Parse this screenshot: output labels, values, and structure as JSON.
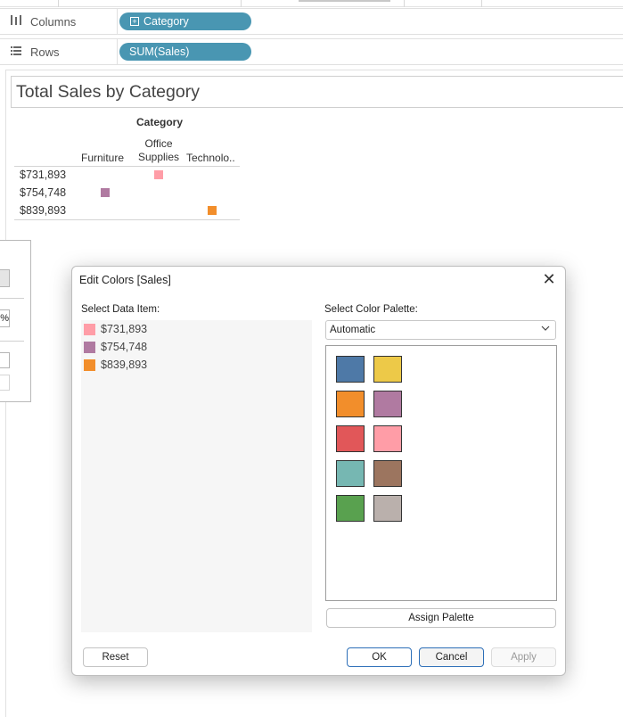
{
  "shelves": {
    "columns": {
      "label": "Columns",
      "icon": "columns-icon",
      "pill": "Category"
    },
    "rows": {
      "label": "Rows",
      "icon": "rows-icon",
      "pill": "SUM(Sales)"
    }
  },
  "sheet": {
    "title": "Total Sales by Category",
    "column_header": "Category",
    "columns": [
      "Furniture",
      "Office Supplies",
      "Technolo.."
    ],
    "rows": [
      "$731,893",
      "$754,748",
      "$839,893"
    ]
  },
  "side_panel": {
    "percent_text": "%"
  },
  "dialog": {
    "title": "Edit Colors [Sales]",
    "select_data_item_label": "Select Data Item:",
    "select_palette_label": "Select Color Palette:",
    "palette_selected": "Automatic",
    "data_items": [
      {
        "label": "$731,893",
        "color": "#ff9da7"
      },
      {
        "label": "$754,748",
        "color": "#b07aa1"
      },
      {
        "label": "$839,893",
        "color": "#f28e2b"
      }
    ],
    "palette_colors": [
      "#4e79a7",
      "#edc948",
      "#f28e2b",
      "#b07aa1",
      "#e15759",
      "#ff9da7",
      "#76b7b2",
      "#9c755f",
      "#59a14f",
      "#bab0ac"
    ],
    "buttons": {
      "assign_palette": "Assign Palette",
      "reset": "Reset",
      "ok": "OK",
      "cancel": "Cancel",
      "apply": "Apply"
    }
  },
  "chart_data": {
    "type": "scatter",
    "title": "Total Sales by Category",
    "x_label": "Category",
    "categories": [
      "Furniture",
      "Office Supplies",
      "Technology"
    ],
    "points": [
      {
        "category": "Office Supplies",
        "label": "$731,893",
        "value": 731893,
        "color": "#ff9da7"
      },
      {
        "category": "Furniture",
        "label": "$754,748",
        "value": 754748,
        "color": "#b07aa1"
      },
      {
        "category": "Technology",
        "label": "$839,893",
        "value": 839893,
        "color": "#f28e2b"
      }
    ]
  }
}
